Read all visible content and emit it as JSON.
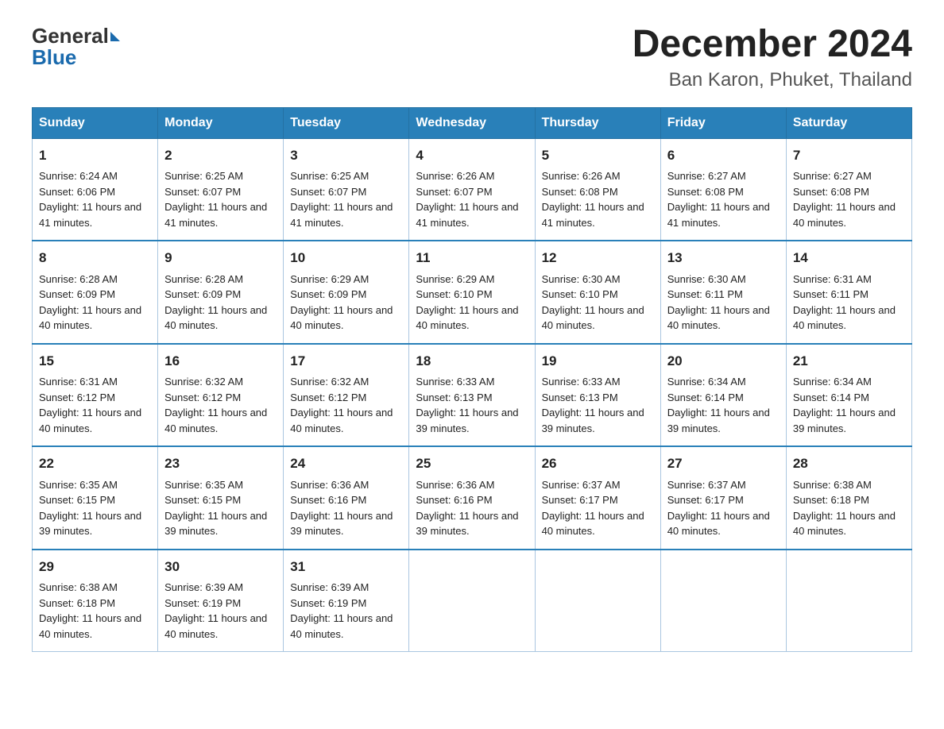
{
  "logo": {
    "text_general": "General",
    "text_blue": "Blue"
  },
  "title": "December 2024",
  "subtitle": "Ban Karon, Phuket, Thailand",
  "days_header": [
    "Sunday",
    "Monday",
    "Tuesday",
    "Wednesday",
    "Thursday",
    "Friday",
    "Saturday"
  ],
  "weeks": [
    [
      {
        "day": "1",
        "sunrise": "Sunrise: 6:24 AM",
        "sunset": "Sunset: 6:06 PM",
        "daylight": "Daylight: 11 hours and 41 minutes."
      },
      {
        "day": "2",
        "sunrise": "Sunrise: 6:25 AM",
        "sunset": "Sunset: 6:07 PM",
        "daylight": "Daylight: 11 hours and 41 minutes."
      },
      {
        "day": "3",
        "sunrise": "Sunrise: 6:25 AM",
        "sunset": "Sunset: 6:07 PM",
        "daylight": "Daylight: 11 hours and 41 minutes."
      },
      {
        "day": "4",
        "sunrise": "Sunrise: 6:26 AM",
        "sunset": "Sunset: 6:07 PM",
        "daylight": "Daylight: 11 hours and 41 minutes."
      },
      {
        "day": "5",
        "sunrise": "Sunrise: 6:26 AM",
        "sunset": "Sunset: 6:08 PM",
        "daylight": "Daylight: 11 hours and 41 minutes."
      },
      {
        "day": "6",
        "sunrise": "Sunrise: 6:27 AM",
        "sunset": "Sunset: 6:08 PM",
        "daylight": "Daylight: 11 hours and 41 minutes."
      },
      {
        "day": "7",
        "sunrise": "Sunrise: 6:27 AM",
        "sunset": "Sunset: 6:08 PM",
        "daylight": "Daylight: 11 hours and 40 minutes."
      }
    ],
    [
      {
        "day": "8",
        "sunrise": "Sunrise: 6:28 AM",
        "sunset": "Sunset: 6:09 PM",
        "daylight": "Daylight: 11 hours and 40 minutes."
      },
      {
        "day": "9",
        "sunrise": "Sunrise: 6:28 AM",
        "sunset": "Sunset: 6:09 PM",
        "daylight": "Daylight: 11 hours and 40 minutes."
      },
      {
        "day": "10",
        "sunrise": "Sunrise: 6:29 AM",
        "sunset": "Sunset: 6:09 PM",
        "daylight": "Daylight: 11 hours and 40 minutes."
      },
      {
        "day": "11",
        "sunrise": "Sunrise: 6:29 AM",
        "sunset": "Sunset: 6:10 PM",
        "daylight": "Daylight: 11 hours and 40 minutes."
      },
      {
        "day": "12",
        "sunrise": "Sunrise: 6:30 AM",
        "sunset": "Sunset: 6:10 PM",
        "daylight": "Daylight: 11 hours and 40 minutes."
      },
      {
        "day": "13",
        "sunrise": "Sunrise: 6:30 AM",
        "sunset": "Sunset: 6:11 PM",
        "daylight": "Daylight: 11 hours and 40 minutes."
      },
      {
        "day": "14",
        "sunrise": "Sunrise: 6:31 AM",
        "sunset": "Sunset: 6:11 PM",
        "daylight": "Daylight: 11 hours and 40 minutes."
      }
    ],
    [
      {
        "day": "15",
        "sunrise": "Sunrise: 6:31 AM",
        "sunset": "Sunset: 6:12 PM",
        "daylight": "Daylight: 11 hours and 40 minutes."
      },
      {
        "day": "16",
        "sunrise": "Sunrise: 6:32 AM",
        "sunset": "Sunset: 6:12 PM",
        "daylight": "Daylight: 11 hours and 40 minutes."
      },
      {
        "day": "17",
        "sunrise": "Sunrise: 6:32 AM",
        "sunset": "Sunset: 6:12 PM",
        "daylight": "Daylight: 11 hours and 40 minutes."
      },
      {
        "day": "18",
        "sunrise": "Sunrise: 6:33 AM",
        "sunset": "Sunset: 6:13 PM",
        "daylight": "Daylight: 11 hours and 39 minutes."
      },
      {
        "day": "19",
        "sunrise": "Sunrise: 6:33 AM",
        "sunset": "Sunset: 6:13 PM",
        "daylight": "Daylight: 11 hours and 39 minutes."
      },
      {
        "day": "20",
        "sunrise": "Sunrise: 6:34 AM",
        "sunset": "Sunset: 6:14 PM",
        "daylight": "Daylight: 11 hours and 39 minutes."
      },
      {
        "day": "21",
        "sunrise": "Sunrise: 6:34 AM",
        "sunset": "Sunset: 6:14 PM",
        "daylight": "Daylight: 11 hours and 39 minutes."
      }
    ],
    [
      {
        "day": "22",
        "sunrise": "Sunrise: 6:35 AM",
        "sunset": "Sunset: 6:15 PM",
        "daylight": "Daylight: 11 hours and 39 minutes."
      },
      {
        "day": "23",
        "sunrise": "Sunrise: 6:35 AM",
        "sunset": "Sunset: 6:15 PM",
        "daylight": "Daylight: 11 hours and 39 minutes."
      },
      {
        "day": "24",
        "sunrise": "Sunrise: 6:36 AM",
        "sunset": "Sunset: 6:16 PM",
        "daylight": "Daylight: 11 hours and 39 minutes."
      },
      {
        "day": "25",
        "sunrise": "Sunrise: 6:36 AM",
        "sunset": "Sunset: 6:16 PM",
        "daylight": "Daylight: 11 hours and 39 minutes."
      },
      {
        "day": "26",
        "sunrise": "Sunrise: 6:37 AM",
        "sunset": "Sunset: 6:17 PM",
        "daylight": "Daylight: 11 hours and 40 minutes."
      },
      {
        "day": "27",
        "sunrise": "Sunrise: 6:37 AM",
        "sunset": "Sunset: 6:17 PM",
        "daylight": "Daylight: 11 hours and 40 minutes."
      },
      {
        "day": "28",
        "sunrise": "Sunrise: 6:38 AM",
        "sunset": "Sunset: 6:18 PM",
        "daylight": "Daylight: 11 hours and 40 minutes."
      }
    ],
    [
      {
        "day": "29",
        "sunrise": "Sunrise: 6:38 AM",
        "sunset": "Sunset: 6:18 PM",
        "daylight": "Daylight: 11 hours and 40 minutes."
      },
      {
        "day": "30",
        "sunrise": "Sunrise: 6:39 AM",
        "sunset": "Sunset: 6:19 PM",
        "daylight": "Daylight: 11 hours and 40 minutes."
      },
      {
        "day": "31",
        "sunrise": "Sunrise: 6:39 AM",
        "sunset": "Sunset: 6:19 PM",
        "daylight": "Daylight: 11 hours and 40 minutes."
      },
      null,
      null,
      null,
      null
    ]
  ]
}
